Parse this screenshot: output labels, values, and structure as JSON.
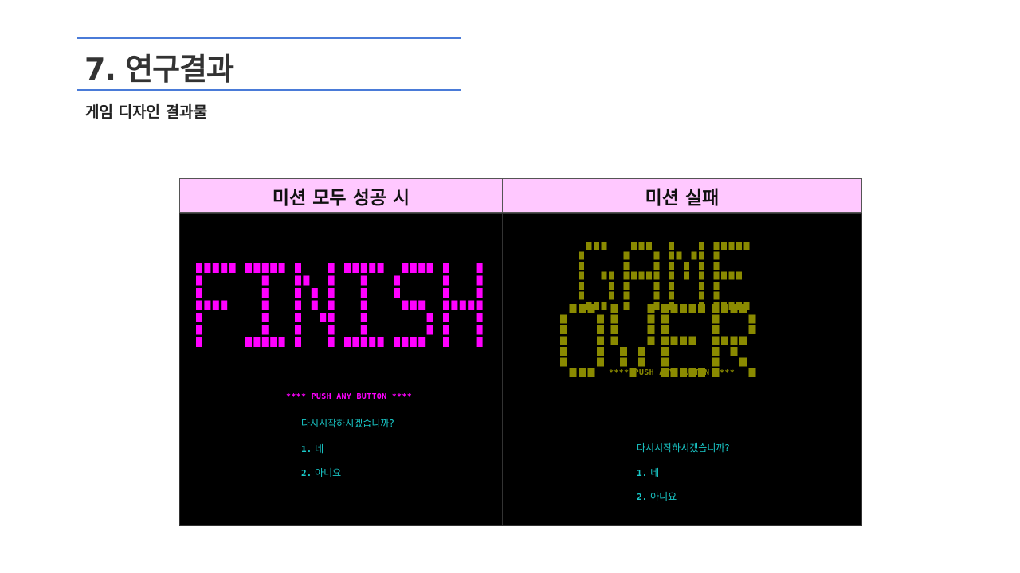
{
  "slide": {
    "title": "7. 연구결과",
    "subtitle": "게임 디자인 결과물"
  },
  "table": {
    "left_header": "미션 모두 성공 시",
    "right_header": "미션 실패"
  },
  "colors": {
    "rule": "#4a7bd8",
    "header_bg": "#ffc8ff",
    "finish_block": "#ff00ff",
    "gameover_block": "#8a8a00",
    "menu_text": "#19c8c8"
  },
  "success_screen": {
    "big_word": "FINISH",
    "push_text": "**** PUSH ANY BUTTON ****",
    "question": "다시시작하시겠습니까?",
    "option1_num": "1.",
    "option1_text": "네",
    "option2_num": "2.",
    "option2_text": "아니요"
  },
  "fail_screen": {
    "big_word_line1": "GAME",
    "big_word_line2": "OVER",
    "push_text": "**** PUSH ANY BUTTON ****",
    "question": "다시시작하시겠습니까?",
    "option1_num": "1.",
    "option1_text": "네",
    "option2_num": "2.",
    "option2_text": "아니요"
  }
}
